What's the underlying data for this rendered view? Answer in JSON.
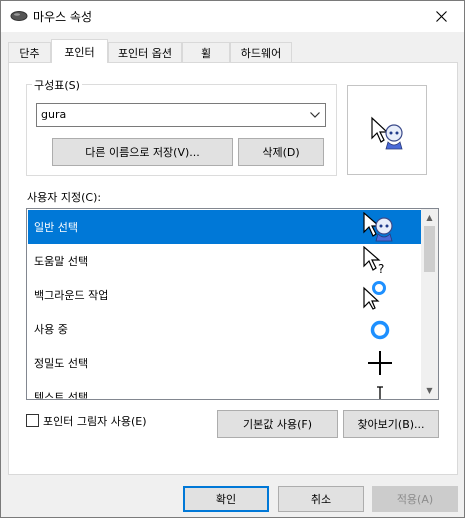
{
  "window": {
    "title": "마우스 속성",
    "icon": "mouse-icon"
  },
  "tabs": [
    {
      "label": "단추"
    },
    {
      "label": "포인터"
    },
    {
      "label": "포인터 옵션"
    },
    {
      "label": "휠"
    },
    {
      "label": "하드웨어"
    }
  ],
  "scheme": {
    "group_label": "구성표(S)",
    "selected": "gura",
    "save_as_label": "다른 이름으로 저장(V)...",
    "delete_label": "삭제(D)"
  },
  "customize": {
    "label": "사용자 지정(C):",
    "items": [
      {
        "label": "일반 선택",
        "icon": "normal-select-cursor"
      },
      {
        "label": "도움말 선택",
        "icon": "help-select-cursor"
      },
      {
        "label": "백그라운드 작업",
        "icon": "working-in-background-cursor"
      },
      {
        "label": "사용 중",
        "icon": "busy-cursor"
      },
      {
        "label": "정밀도 선택",
        "icon": "precision-select-cursor"
      },
      {
        "label": "텍스트 선택",
        "icon": "text-select-cursor"
      }
    ],
    "selected_index": 0
  },
  "options": {
    "shadow_label": "포인터 그림자 사용(E)",
    "shadow_checked": false,
    "defaults_label": "기본값 사용(F)",
    "browse_label": "찾아보기(B)..."
  },
  "footer": {
    "ok_label": "확인",
    "cancel_label": "취소",
    "apply_label": "적용(A)"
  },
  "colors": {
    "selection": "#0078d7",
    "ring": "#1e90ff"
  }
}
